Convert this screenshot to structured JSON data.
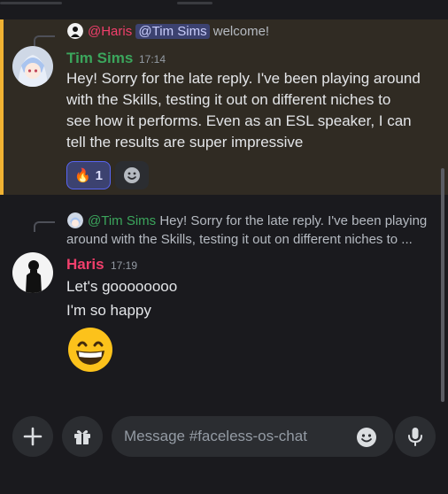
{
  "pinned_message": {
    "reply": {
      "author_mention": "@Haris",
      "mention": "@Tim Sims",
      "text": "welcome!"
    },
    "author": "Tim Sims",
    "author_color": "#3ba55c",
    "time": "17:14",
    "lines": [
      "Hey! Sorry for the late reply. I've been playing around",
      "with the Skills, testing it out on different niches to",
      "see how it performs. Even as an ESL speaker, I can",
      "tell the results are super impressive"
    ],
    "reaction": {
      "emoji": "🔥",
      "count": "1"
    }
  },
  "second_message": {
    "reply": {
      "mention": "@Tim Sims",
      "line1": "Hey! Sorry for the late reply. I've been playing",
      "line2": "around with the Skills, testing it out on different niches to ..."
    },
    "author": "Haris",
    "author_color": "#f23f6c",
    "time": "17:19",
    "lines": [
      "Let's goooooooo",
      "I'm so happy"
    ],
    "emoji": "😁"
  },
  "composer": {
    "placeholder": "Message #faceless-os-chat"
  },
  "icons": {
    "add": "plus-icon",
    "gift": "gift-icon",
    "emoji": "smile-icon",
    "voice": "microphone-icon"
  },
  "colors": {
    "highlight_bar": "#f0b232",
    "highlight_bg": "#302b23",
    "background": "#1a1a1e",
    "mention_bg": "#3c4270"
  }
}
